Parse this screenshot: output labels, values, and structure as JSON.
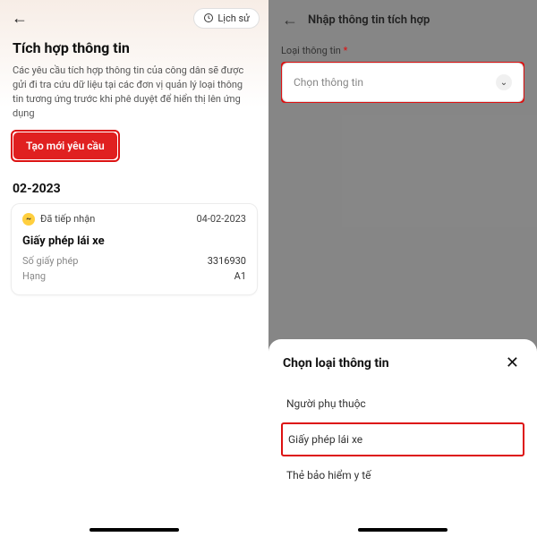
{
  "left": {
    "history_label": "Lịch sử",
    "title": "Tích hợp thông tin",
    "description": "Các yêu cầu tích hợp thông tin của công dân sẽ được gửi đi tra cứu dữ liệu tại các đơn vị quản lý loại thông tin tương ứng trước khi phê duyệt để hiển thị lên ứng dụng",
    "primary_button": "Tạo mới yêu cầu",
    "month": "02-2023",
    "card": {
      "status": "Đã tiếp nhận",
      "date": "04-02-2023",
      "title": "Giấy phép lái xe",
      "rows": [
        {
          "label": "Số giấy phép",
          "value": "3316930"
        },
        {
          "label": "Hạng",
          "value": "A1"
        }
      ]
    }
  },
  "right": {
    "header_title": "Nhập thông tin tích hợp",
    "field_label": "Loại thông tin",
    "select_placeholder": "Chọn thông tin",
    "sheet": {
      "title": "Chọn loại thông tin",
      "options": [
        "Người phụ thuộc",
        "Giấy phép lái xe",
        "Thẻ bảo hiểm y tế"
      ]
    }
  }
}
